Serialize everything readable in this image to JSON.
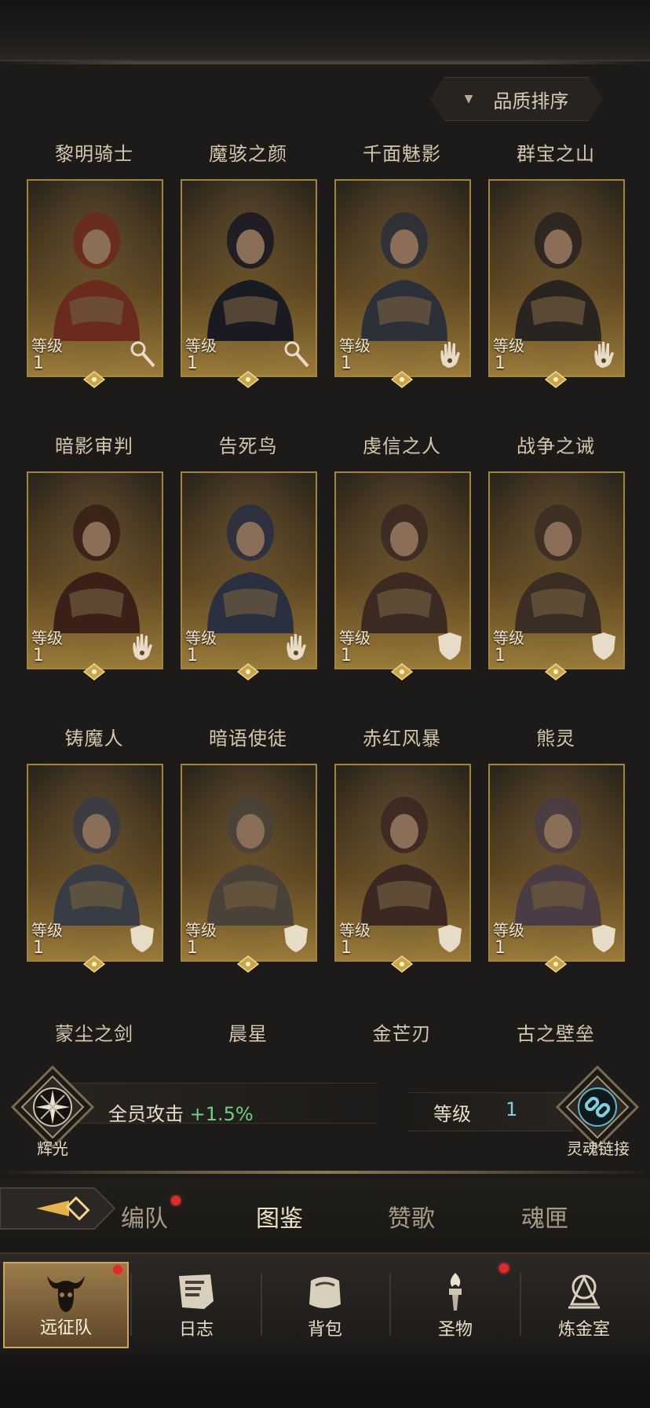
{
  "sort": {
    "label": "品质排序"
  },
  "heroes": [
    {
      "name": "黎明骑士",
      "level_label": "等级",
      "level": "1",
      "class_icon": "staff-icon"
    },
    {
      "name": "魔骇之颜",
      "level_label": "等级",
      "level": "1",
      "class_icon": "staff-icon"
    },
    {
      "name": "千面魅影",
      "level_label": "等级",
      "level": "1",
      "class_icon": "hand-icon"
    },
    {
      "name": "群宝之山",
      "level_label": "等级",
      "level": "1",
      "class_icon": "hand-icon"
    },
    {
      "name": "暗影审判",
      "level_label": "等级",
      "level": "1",
      "class_icon": "hand-icon"
    },
    {
      "name": "告死鸟",
      "level_label": "等级",
      "level": "1",
      "class_icon": "hand-icon"
    },
    {
      "name": "虔信之人",
      "level_label": "等级",
      "level": "1",
      "class_icon": "shield-icon"
    },
    {
      "name": "战争之诫",
      "level_label": "等级",
      "level": "1",
      "class_icon": "shield-icon"
    },
    {
      "name": "铸魔人",
      "level_label": "等级",
      "level": "1",
      "class_icon": "shield-icon"
    },
    {
      "name": "暗语使徒",
      "level_label": "等级",
      "level": "1",
      "class_icon": "shield-icon"
    },
    {
      "name": "赤红风暴",
      "level_label": "等级",
      "level": "1",
      "class_icon": "shield-icon"
    },
    {
      "name": "熊灵",
      "level_label": "等级",
      "level": "1",
      "class_icon": "shield-icon"
    }
  ],
  "next_row_names": [
    "蒙尘之剑",
    "晨星",
    "金芒刃",
    "古之壁垒"
  ],
  "buff": {
    "emblem_label": "辉光",
    "text": "全员攻击",
    "value": "+1.5%"
  },
  "soul_link": {
    "level_label": "等级",
    "level": "1",
    "emblem_label": "灵魂链接"
  },
  "tabs": [
    {
      "label": "编队",
      "active": false,
      "badge": true
    },
    {
      "label": "图鉴",
      "active": true,
      "badge": false
    },
    {
      "label": "赞歌",
      "active": false,
      "badge": false
    },
    {
      "label": "魂匣",
      "active": false,
      "badge": false
    }
  ],
  "nav": [
    {
      "label": "远征队",
      "icon": "horned-skull-icon",
      "active": true,
      "badge": true
    },
    {
      "label": "日志",
      "icon": "scroll-icon",
      "active": false,
      "badge": false
    },
    {
      "label": "背包",
      "icon": "bag-icon",
      "active": false,
      "badge": false
    },
    {
      "label": "圣物",
      "icon": "torch-icon",
      "active": false,
      "badge": true
    },
    {
      "label": "炼金室",
      "icon": "alchemy-icon",
      "active": false,
      "badge": false
    }
  ],
  "colors": {
    "gold_frame": "#a1843f",
    "buff_green": "#6fd184",
    "level_cyan": "#7fd0e0",
    "badge_red": "#e02a2a"
  }
}
